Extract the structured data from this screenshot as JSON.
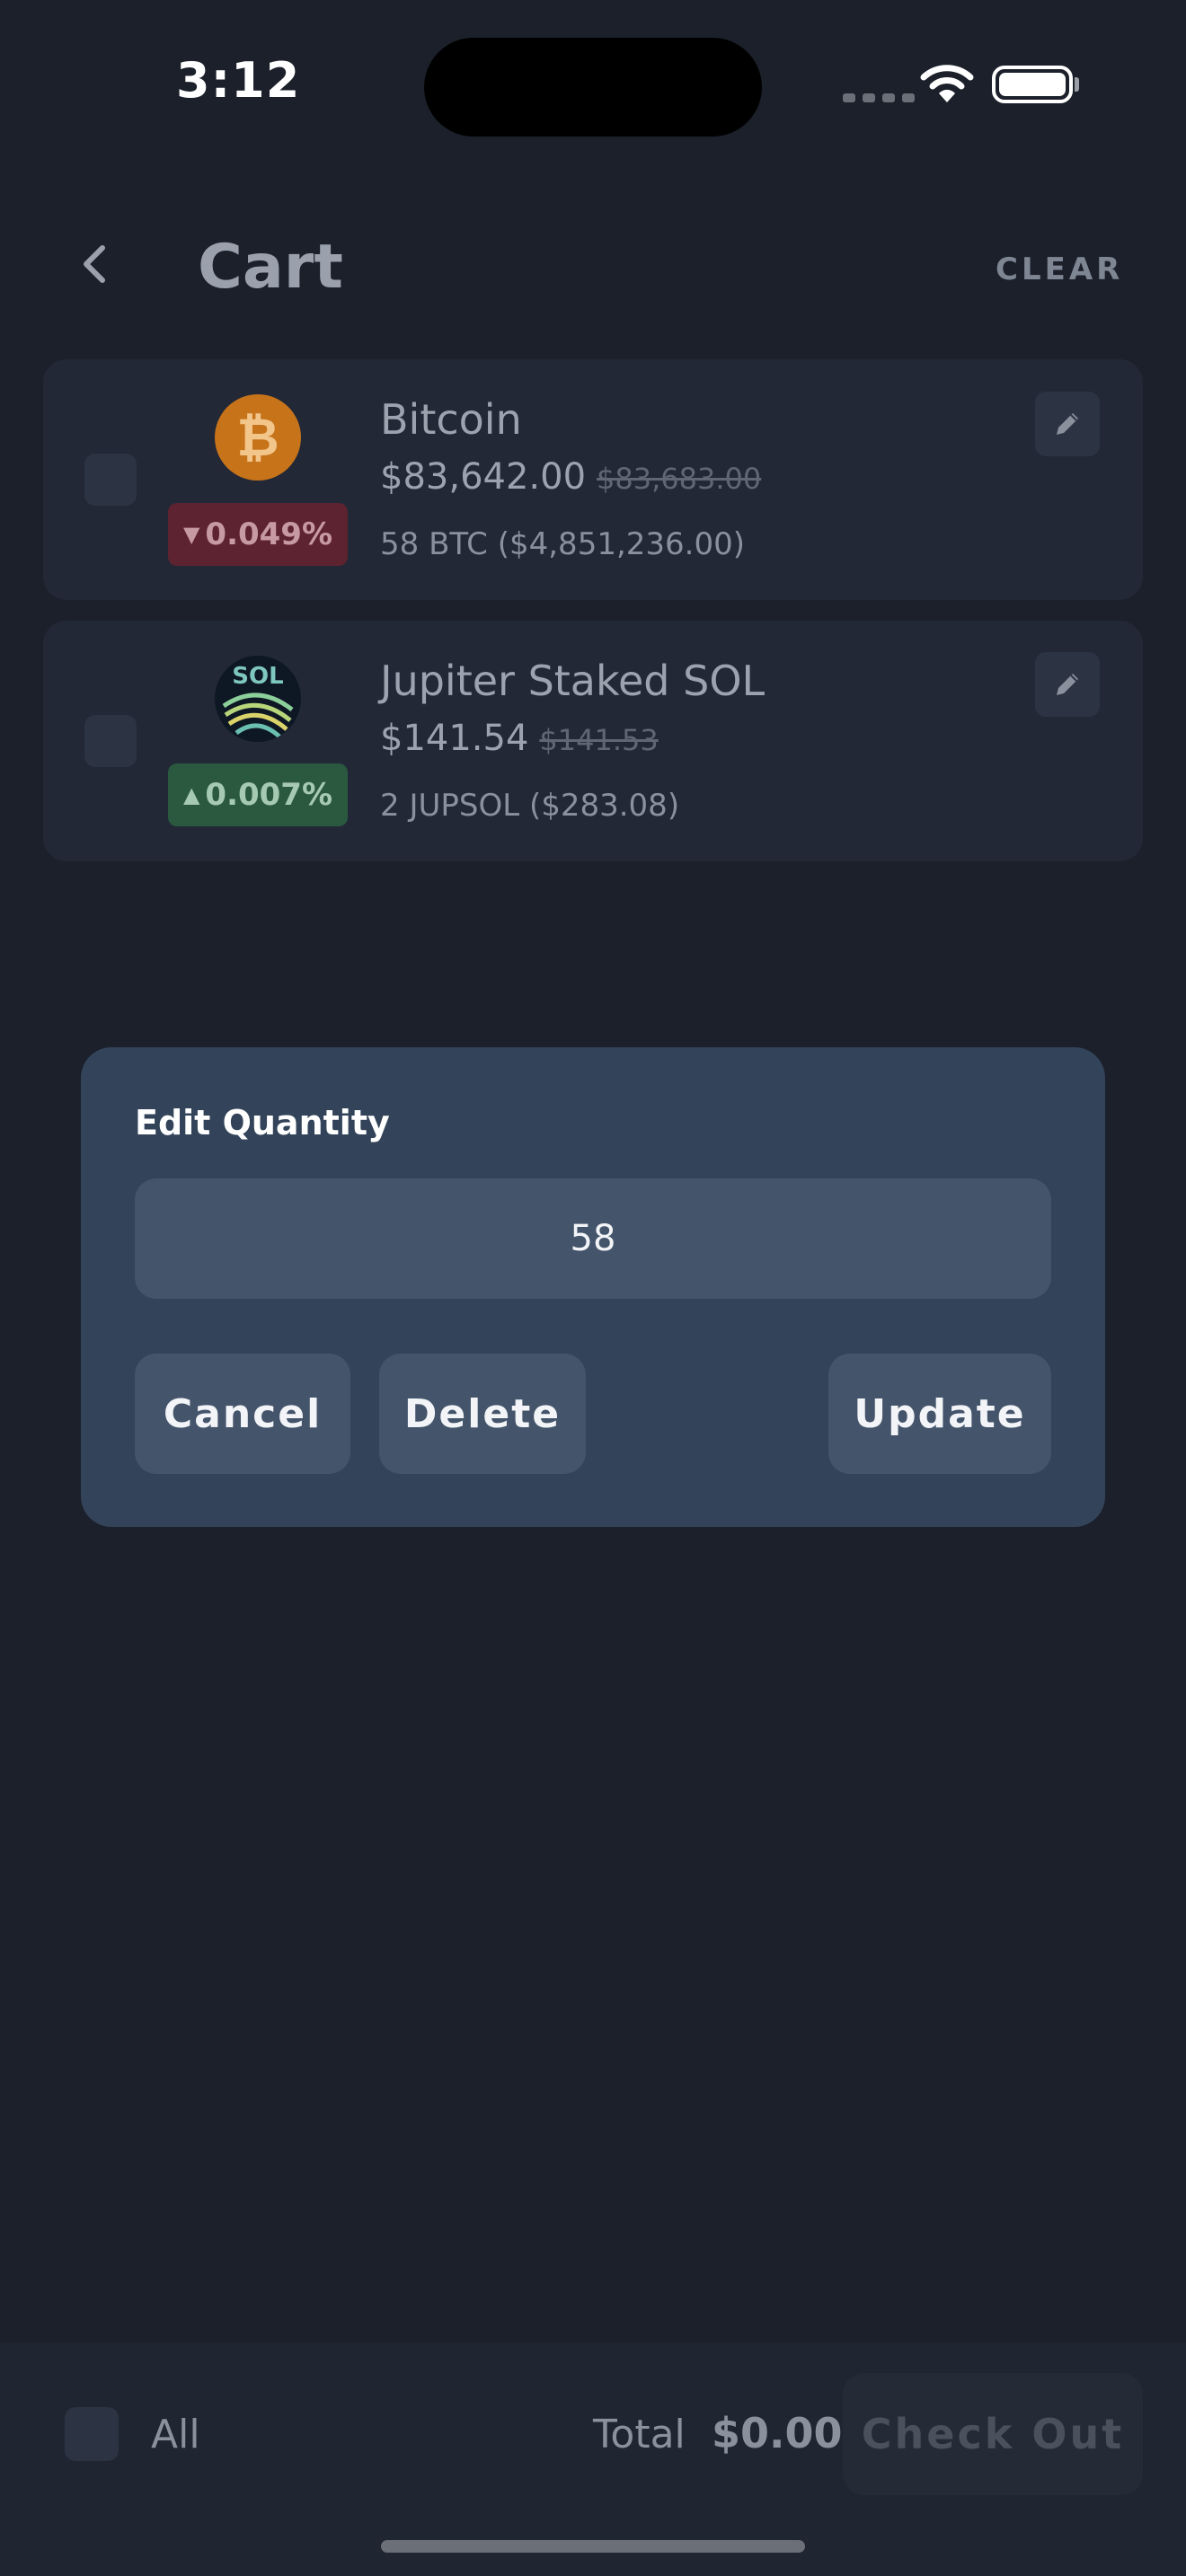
{
  "status_bar": {
    "time": "3:12",
    "icons": [
      "signal-icon",
      "wifi-icon",
      "battery-icon"
    ]
  },
  "header": {
    "back_icon": "chevron-left-icon",
    "title": "Cart",
    "clear_label": "CLEAR"
  },
  "cart": {
    "items": [
      {
        "name": "Bitcoin",
        "price": "$83,642.00",
        "old_price": "$83,683.00",
        "change": "0.049%",
        "direction": "down",
        "quantity_line": "58 BTC ($4,851,236.00)",
        "icon": "bitcoin-icon",
        "icon_glyph": "₿",
        "checked": false
      },
      {
        "name": "Jupiter Staked SOL",
        "price": "$141.54",
        "old_price": "$141.53",
        "change": "0.007%",
        "direction": "up",
        "quantity_line": "2 JUPSOL ($283.08)",
        "icon": "jupsol-icon",
        "icon_text": "SOL",
        "checked": false
      }
    ]
  },
  "modal": {
    "title": "Edit Quantity",
    "quantity_value": "58",
    "cancel_label": "Cancel",
    "delete_label": "Delete",
    "update_label": "Update"
  },
  "bottom_bar": {
    "all_label": "All",
    "total_label": "Total",
    "total_value": "$0.00",
    "checkout_label": "Check Out"
  },
  "colors": {
    "background": "#1b202b",
    "modal": "#334359",
    "modal_control": "#44546b",
    "badge_down": "#5e2330",
    "badge_up": "#2a5940",
    "bitcoin": "#c7731a"
  }
}
